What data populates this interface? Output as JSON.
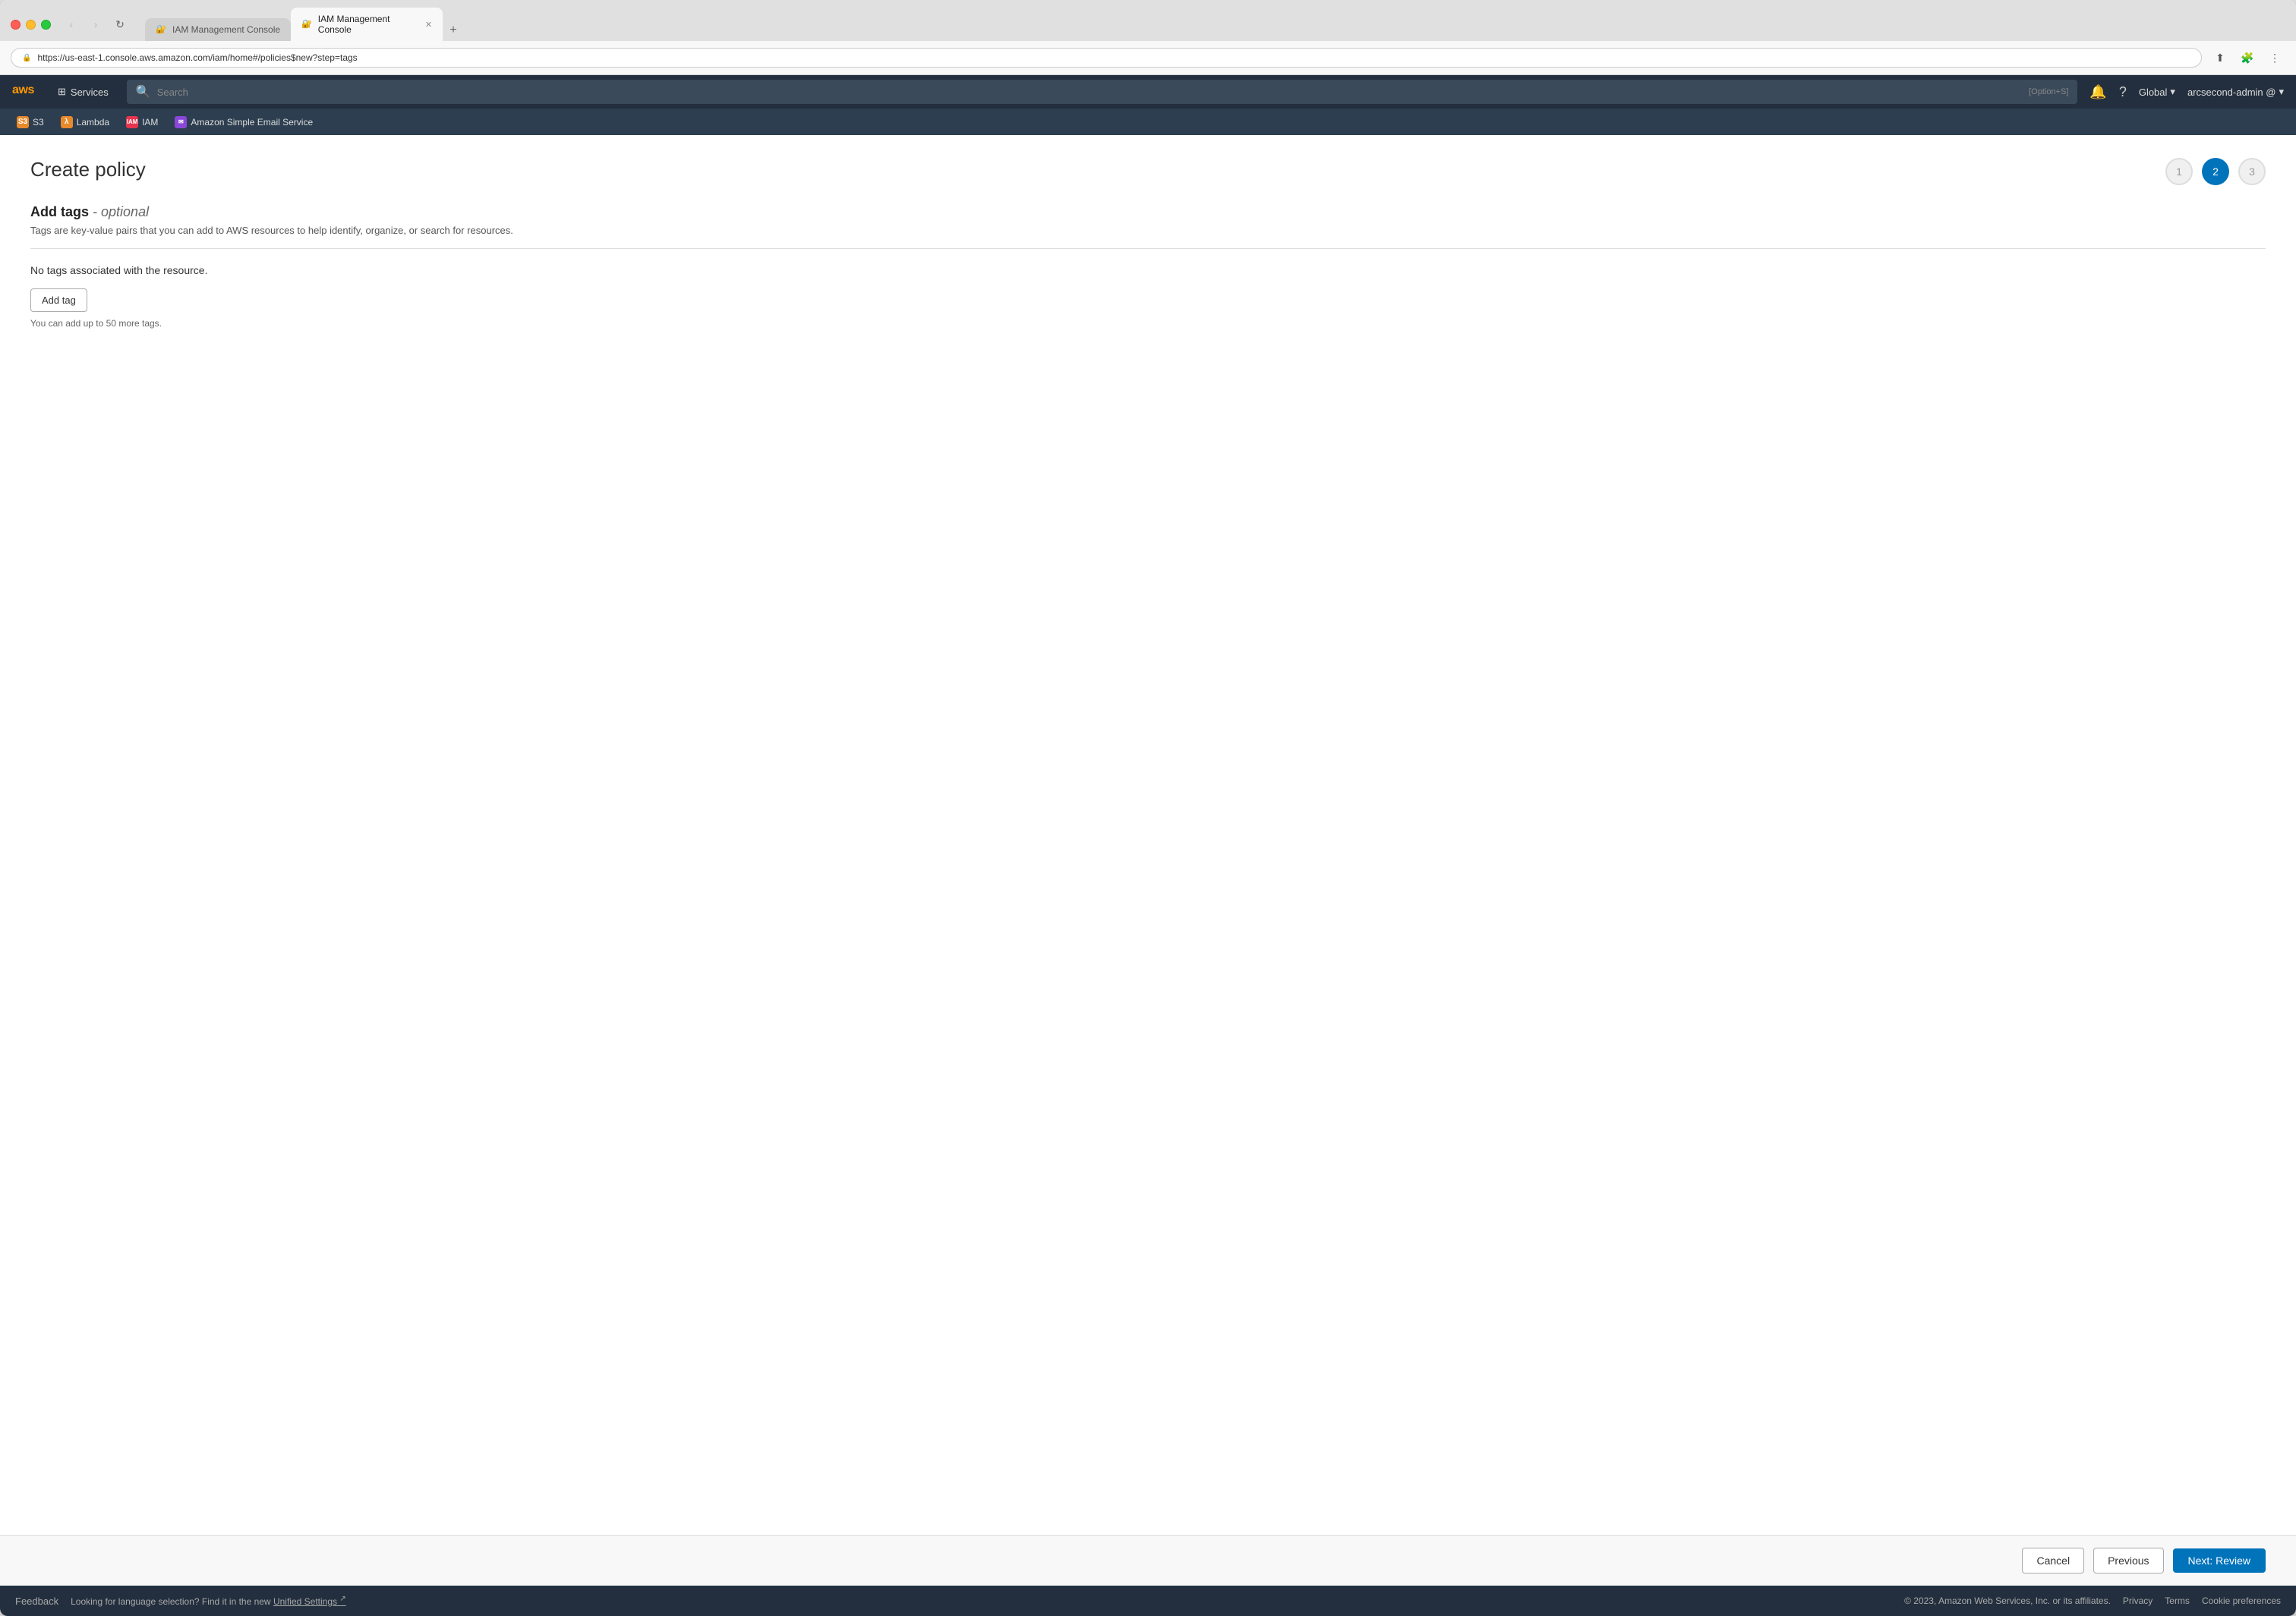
{
  "browser": {
    "tabs": [
      {
        "id": "tab1",
        "label": "IAM Management Console",
        "favicon": "🔐",
        "active": false
      },
      {
        "id": "tab2",
        "label": "IAM Management Console",
        "favicon": "🔐",
        "active": true,
        "closable": true
      }
    ],
    "new_tab_label": "+",
    "address": "https://us-east-1.console.aws.amazon.com/iam/home#/policies$new?step=tags",
    "nav": {
      "back": "‹",
      "forward": "›",
      "refresh": "↺"
    }
  },
  "aws_nav": {
    "logo": "aws",
    "services_label": "Services",
    "search_placeholder": "Search",
    "search_shortcut": "[Option+S]",
    "bell_icon": "🔔",
    "help_icon": "?",
    "region_label": "Global",
    "user_label": "arcsecond-admin @"
  },
  "bookmarks": [
    {
      "id": "s3",
      "label": "S3",
      "icon": "S3",
      "color": "#e8892b"
    },
    {
      "id": "lambda",
      "label": "Lambda",
      "icon": "λ",
      "color": "#e8892b"
    },
    {
      "id": "iam",
      "label": "IAM",
      "icon": "IAM",
      "color": "#e8344e"
    },
    {
      "id": "ses",
      "label": "Amazon Simple Email Service",
      "icon": "SES",
      "color": "#8b47d9"
    }
  ],
  "page": {
    "title": "Create policy",
    "steps": [
      {
        "number": "1",
        "state": "inactive"
      },
      {
        "number": "2",
        "state": "active"
      },
      {
        "number": "3",
        "state": "inactive"
      }
    ]
  },
  "tags_section": {
    "title": "Add tags",
    "optional_label": "- optional",
    "description": "Tags are key-value pairs that you can add to AWS resources to help identify, organize, or search for resources.",
    "no_tags_text": "No tags associated with the resource.",
    "add_tag_label": "Add tag",
    "tags_limit_text": "You can add up to 50 more tags."
  },
  "bottom_bar": {
    "cancel_label": "Cancel",
    "previous_label": "Previous",
    "next_label": "Next: Review"
  },
  "footer": {
    "feedback_label": "Feedback",
    "message": "Looking for language selection? Find it in the new",
    "unified_settings_label": "Unified Settings",
    "copyright": "© 2023, Amazon Web Services, Inc. or its affiliates.",
    "privacy_label": "Privacy",
    "terms_label": "Terms",
    "cookie_label": "Cookie preferences"
  }
}
